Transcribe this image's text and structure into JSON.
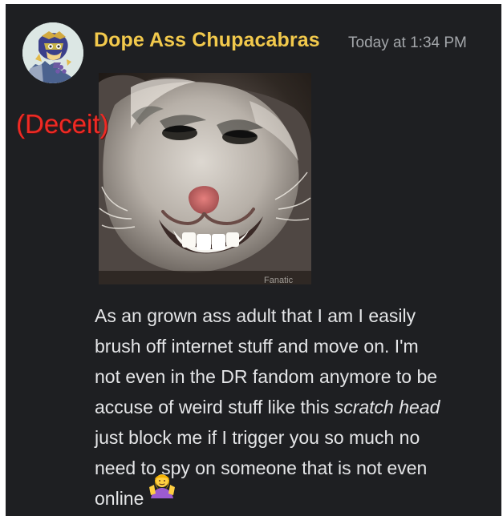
{
  "message": {
    "username": "Dope Ass Chupacabras",
    "timestamp": "Today at 1:34 PM",
    "overlay_label": "(Deceit)",
    "image_watermark": "Fanatic",
    "text": {
      "line_1": "As an grown ass adult that I am I easily",
      "line_2": "brush off internet stuff and move on. I'm",
      "line_3": "not even in the DR fandom anymore to be",
      "line_4_start": "accuse of weird stuff like this ",
      "line_4_italic": "scratch head",
      "line_5": "just block me if I trigger you so much no",
      "line_6": "need to spy on someone that is not even",
      "line_7": "online"
    },
    "emoji_name": "person-shrugging-emoji"
  },
  "colors": {
    "background": "#1e1f22",
    "username": "#f2c94c",
    "timestamp": "#a3a6aa",
    "body_text": "#e4e5e7",
    "overlay_label": "#ef2a24"
  }
}
